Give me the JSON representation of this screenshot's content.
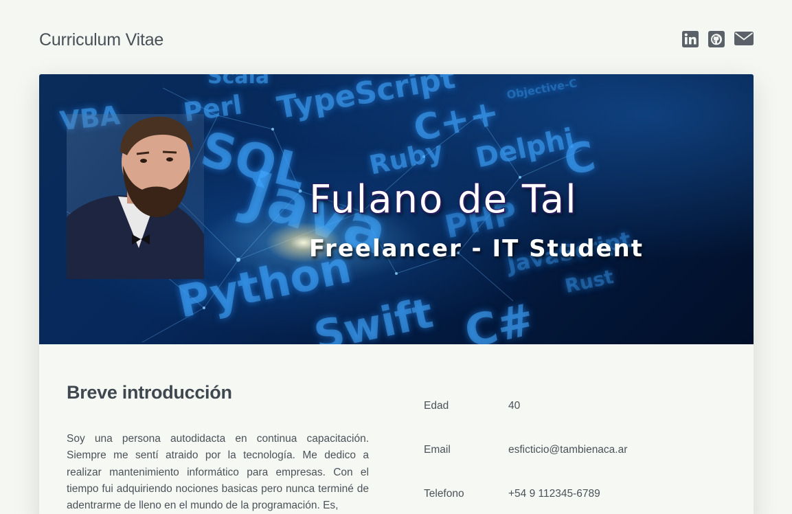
{
  "header": {
    "title": "Curriculum Vitae",
    "social": [
      {
        "icon": "linkedin-icon"
      },
      {
        "icon": "github-icon"
      },
      {
        "icon": "envelope-icon"
      }
    ]
  },
  "banner": {
    "name": "Fulano de Tal",
    "role": "Freelancer - IT Student",
    "code_words": [
      "Scala",
      "VBA",
      "Perl",
      "TypeScript",
      "C++",
      "SQL",
      "Ruby",
      "Delphi",
      "Java",
      "C",
      "PHP",
      "Python",
      "Swift",
      "JavaScript",
      "Rust",
      "C#",
      "Objective-C"
    ]
  },
  "intro": {
    "title": "Breve introducción",
    "text": "Soy una persona autodidacta en continua capacitación. Siempre me sentí atraido por la tecnología. Me dedico a realizar mantenimiento informático para empresas. Con el tiempo fui adquiriendo nociones basicas pero nunca terminé de adentrarme de lleno en el mundo de la programación. Es,"
  },
  "info": [
    {
      "label": "Edad",
      "value": "40"
    },
    {
      "label": "Email",
      "value": "esficticio@tambienaca.ar"
    },
    {
      "label": "Telefono",
      "value": "+54 9 112345-6789"
    }
  ],
  "colors": {
    "page_bg": "#f4f7f2",
    "icon_gray": "#5a6168",
    "banner_blue": "#06285b"
  }
}
